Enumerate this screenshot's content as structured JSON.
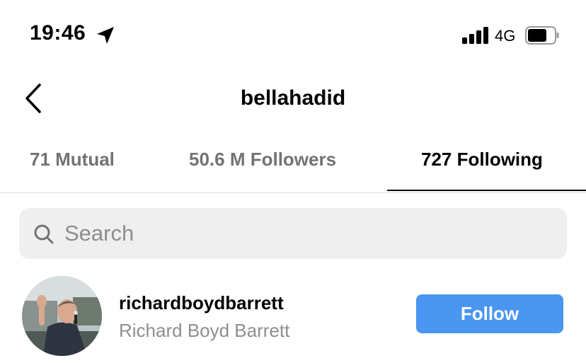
{
  "status_bar": {
    "time": "19:46",
    "network": "4G",
    "icons": [
      "location-arrow-icon",
      "signal-icon",
      "battery-icon"
    ]
  },
  "header": {
    "back_icon": "chevron-left-icon",
    "title": "bellahadid"
  },
  "tabs": [
    {
      "label": "71 Mutual",
      "active": false
    },
    {
      "label": "50.6 M Followers",
      "active": false
    },
    {
      "label": "727 Following",
      "active": true
    }
  ],
  "search": {
    "placeholder": "Search",
    "value": "",
    "icon": "search-icon"
  },
  "list": [
    {
      "username": "richardboydbarrett",
      "full_name": "Richard Boyd Barrett",
      "button_label": "Follow"
    }
  ],
  "colors": {
    "follow_button": "#4a96f0",
    "inactive_tab": "#737373",
    "search_bg": "#efefef"
  }
}
